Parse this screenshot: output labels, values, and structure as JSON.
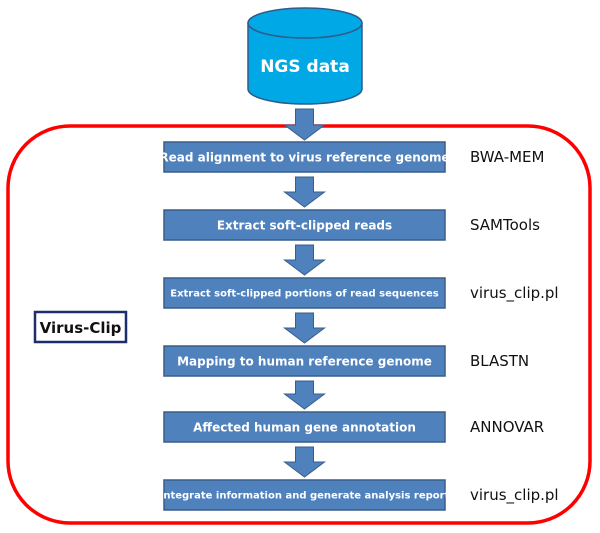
{
  "diagram": {
    "source": {
      "label": "NGS data",
      "shape": "database-cylinder",
      "fill_color": "#00A9E6",
      "stroke_color": "#2F5C8A"
    },
    "container": {
      "label": "Virus-Clip",
      "border_color": "#FF0000",
      "label_border_color": "#1F2D6B"
    },
    "step_style": {
      "fill_color": "#4F81BD",
      "stroke_color": "#385D8A",
      "text_color": "#FFFFFF",
      "arrow_color": "#4F81BD"
    },
    "steps": [
      {
        "label": "Read alignment to virus reference genome",
        "tool": "BWA-MEM"
      },
      {
        "label": "Extract soft-clipped reads",
        "tool": "SAMTools"
      },
      {
        "label": "Extract soft-clipped portions of read sequences",
        "tool": "virus_clip.pl"
      },
      {
        "label": "Mapping to human reference genome",
        "tool": "BLASTN"
      },
      {
        "label": "Affected human gene annotation",
        "tool": "ANNOVAR"
      },
      {
        "label": "Integrate information and generate analysis report",
        "tool": "virus_clip.pl"
      }
    ]
  }
}
